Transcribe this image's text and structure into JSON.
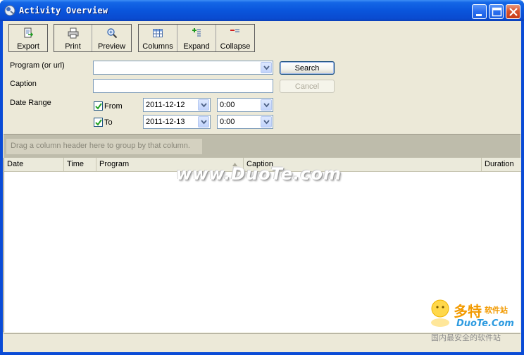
{
  "window": {
    "title": "Activity Overview",
    "accent_color": "#0a4bd6"
  },
  "toolbar": {
    "groups": [
      [
        {
          "label": "Export",
          "icon": "export-icon"
        }
      ],
      [
        {
          "label": "Print",
          "icon": "printer-icon"
        },
        {
          "label": "Preview",
          "icon": "magnifier-icon"
        }
      ],
      [
        {
          "label": "Columns",
          "icon": "columns-icon"
        },
        {
          "label": "Expand",
          "icon": "expand-icon"
        },
        {
          "label": "Collapse",
          "icon": "collapse-icon"
        }
      ]
    ]
  },
  "form": {
    "program_label": "Program (or url)",
    "program_value": "",
    "caption_label": "Caption",
    "caption_value": "",
    "date_range_label": "Date Range",
    "from_label": "From",
    "from_checked": true,
    "from_date": "2011-12-12",
    "from_time": "0:00",
    "to_label": "To",
    "to_checked": true,
    "to_date": "2011-12-13",
    "to_time": "0:00",
    "search_label": "Search",
    "cancel_label": "Cancel"
  },
  "grid": {
    "group_hint": "Drag a column header here to group by that column.",
    "columns": [
      "Date",
      "Time",
      "Program",
      "Caption",
      "Duration"
    ],
    "sorted_column": "Program",
    "rows": []
  },
  "watermark": {
    "text": "www.DuoTe.com",
    "corner_big": "多特",
    "corner_small": "软件站",
    "corner_url": "DuoTe.Com",
    "corner_cn": "国内最安全的软件站"
  }
}
